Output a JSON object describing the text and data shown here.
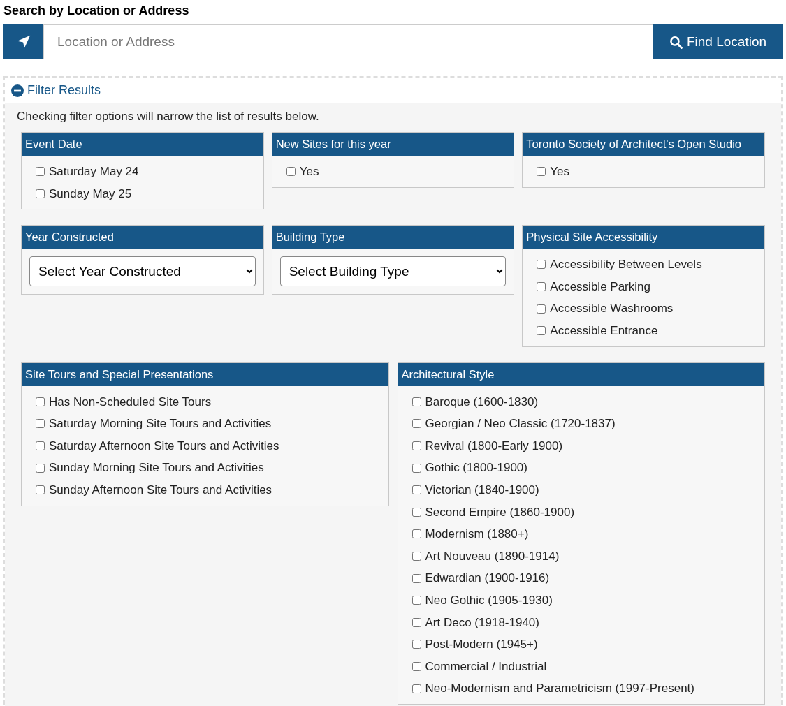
{
  "search": {
    "title": "Search by Location or Address",
    "placeholder": "Location or Address",
    "button": "Find Location"
  },
  "filter": {
    "title": "Filter Results",
    "expanded": true,
    "hint": "Checking filter options will narrow the list of results below.",
    "sections": [
      {
        "title": "Event Date",
        "kind": "checkboxes",
        "options": [
          {
            "label": "Saturday May 24",
            "checked": false
          },
          {
            "label": "Sunday May 25",
            "checked": false
          }
        ]
      },
      {
        "title": "New Sites for this year",
        "kind": "checkboxes",
        "options": [
          {
            "label": "Yes",
            "checked": false
          }
        ]
      },
      {
        "title": "Toronto Society of Architect's Open Studio",
        "kind": "checkboxes",
        "options": [
          {
            "label": "Yes",
            "checked": false
          }
        ]
      },
      {
        "title": "Year Constructed",
        "kind": "select",
        "value": "Select Year Constructed"
      },
      {
        "title": "Building Type",
        "kind": "select",
        "value": "Select Building Type"
      },
      {
        "title": "Physical Site Accessibility",
        "kind": "checkboxes",
        "options": [
          {
            "label": "Accessibility Between Levels",
            "checked": false
          },
          {
            "label": "Accessible Parking",
            "checked": false
          },
          {
            "label": "Accessible Washrooms",
            "checked": false
          },
          {
            "label": "Accessible Entrance",
            "checked": false
          }
        ]
      },
      {
        "title": "Site Tours and Special Presentations",
        "kind": "checkboxes",
        "options": [
          {
            "label": "Has Non-Scheduled Site Tours",
            "checked": false
          },
          {
            "label": "Saturday Morning Site Tours and Activities",
            "checked": false
          },
          {
            "label": "Saturday Afternoon Site Tours and Activities",
            "checked": false
          },
          {
            "label": "Sunday Morning Site Tours and Activities",
            "checked": false
          },
          {
            "label": "Sunday Afternoon Site Tours and Activities",
            "checked": false
          }
        ]
      },
      {
        "title": "Architectural Style",
        "kind": "checkboxes",
        "options": [
          {
            "label": "Baroque (1600-1830)",
            "checked": false
          },
          {
            "label": "Georgian / Neo Classic (1720-1837)",
            "checked": false
          },
          {
            "label": "Revival (1800-Early 1900)",
            "checked": false
          },
          {
            "label": "Gothic (1800-1900)",
            "checked": false
          },
          {
            "label": "Victorian (1840-1900)",
            "checked": false
          },
          {
            "label": "Second Empire (1860-1900)",
            "checked": false
          },
          {
            "label": "Modernism (1880+)",
            "checked": false
          },
          {
            "label": "Art Nouveau (1890-1914)",
            "checked": false
          },
          {
            "label": "Edwardian (1900-1916)",
            "checked": false
          },
          {
            "label": "Neo Gothic (1905-1930)",
            "checked": false
          },
          {
            "label": "Art Deco (1918-1940)",
            "checked": false
          },
          {
            "label": "Post-Modern (1945+)",
            "checked": false
          },
          {
            "label": "Commercial / Industrial",
            "checked": false
          },
          {
            "label": "Neo-Modernism and Parametricism (1997-Present)",
            "checked": false
          }
        ]
      }
    ]
  }
}
